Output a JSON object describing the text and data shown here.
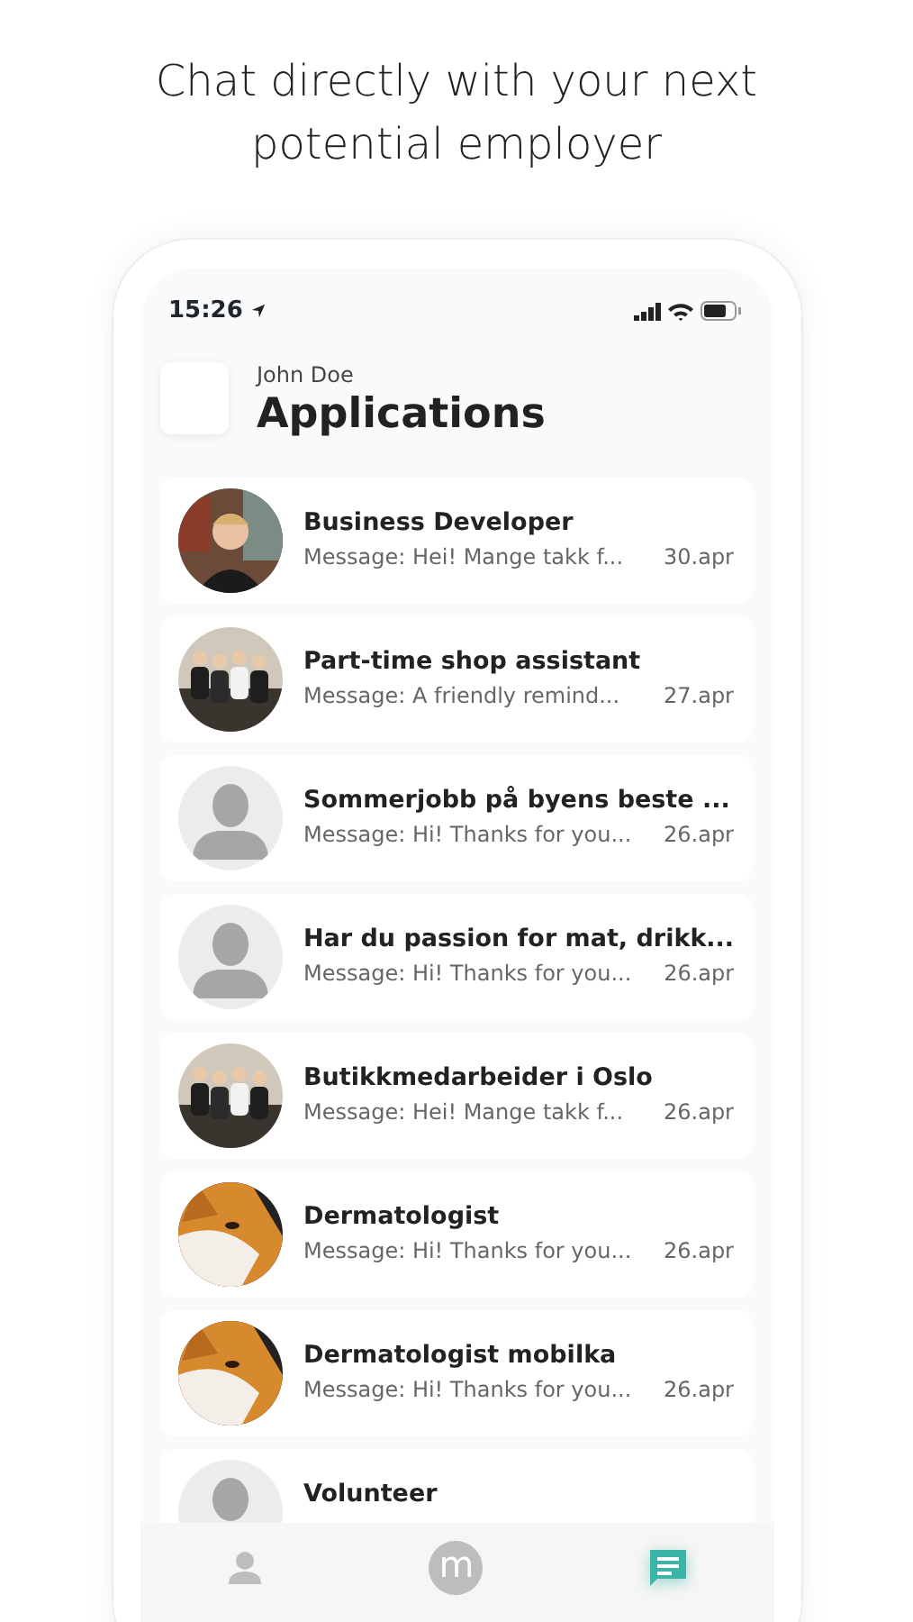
{
  "headline": "Chat directly with your next potential employer",
  "status_bar": {
    "time": "15:26"
  },
  "header": {
    "user": "John Doe",
    "title": "Applications"
  },
  "applications": [
    {
      "title": "Business Developer",
      "message": "Message: Hei! Mange takk f...",
      "date": "30.apr",
      "kind": "person"
    },
    {
      "title": "Part-time shop assistant",
      "message": "Message: A friendly remind...",
      "date": "27.apr",
      "kind": "group"
    },
    {
      "title": "Sommerjobb på byens beste ...",
      "message": "Message: Hi! Thanks for you...",
      "date": "26.apr",
      "kind": "placeholder"
    },
    {
      "title": "Har du passion for mat, drikk...",
      "message": "Message: Hi! Thanks for you...",
      "date": "26.apr",
      "kind": "placeholder"
    },
    {
      "title": "Butikkmedarbeider i Oslo",
      "message": "Message: Hei! Mange takk f...",
      "date": "26.apr",
      "kind": "group"
    },
    {
      "title": "Dermatologist",
      "message": "Message: Hi! Thanks for you...",
      "date": "26.apr",
      "kind": "fox"
    },
    {
      "title": "Dermatologist mobilka",
      "message": "Message: Hi! Thanks for you...",
      "date": "26.apr",
      "kind": "fox"
    },
    {
      "title": "Volunteer",
      "kind": "placeholder"
    }
  ],
  "tab_bar": [
    {
      "kind": "profile",
      "selected": false
    },
    {
      "kind": "logo",
      "label": "m",
      "selected": false
    },
    {
      "kind": "chat",
      "selected": true
    }
  ]
}
